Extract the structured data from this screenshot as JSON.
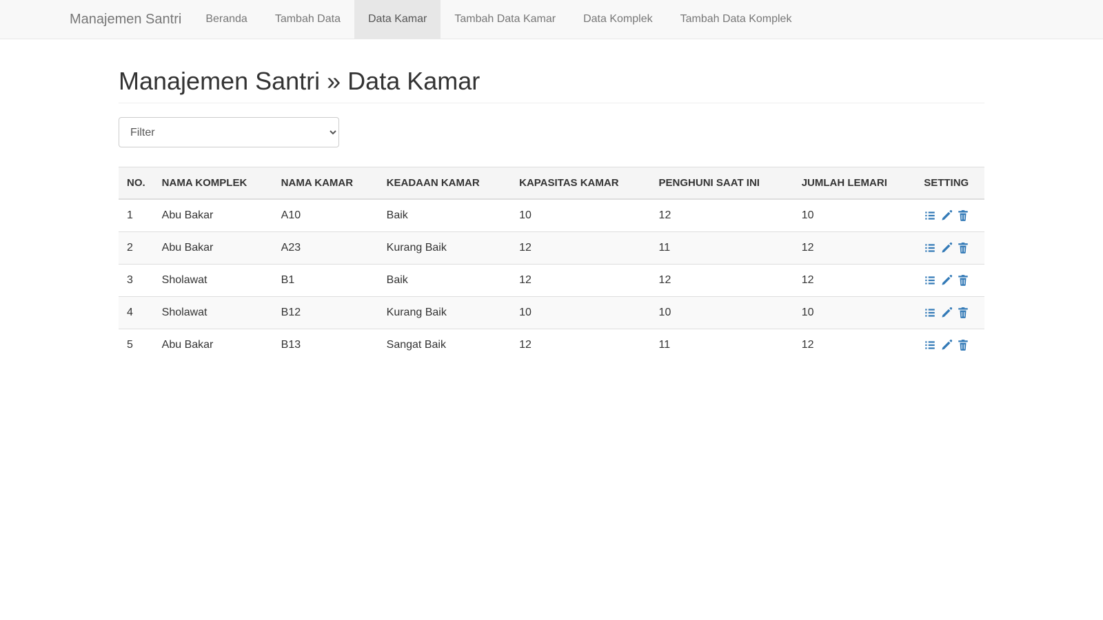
{
  "brand": "Manajemen Santri",
  "nav": [
    {
      "label": "Beranda",
      "active": false
    },
    {
      "label": "Tambah Data",
      "active": false
    },
    {
      "label": "Data Kamar",
      "active": true
    },
    {
      "label": "Tambah Data Kamar",
      "active": false
    },
    {
      "label": "Data Komplek",
      "active": false
    },
    {
      "label": "Tambah Data Komplek",
      "active": false
    }
  ],
  "page_title": "Manajemen Santri » Data Kamar",
  "filter": {
    "placeholder": "Filter"
  },
  "table": {
    "headers": {
      "no": "NO.",
      "nama_komplek": "NAMA KOMPLEK",
      "nama_kamar": "NAMA KAMAR",
      "keadaan_kamar": "KEADAAN KAMAR",
      "kapasitas_kamar": "KAPASITAS KAMAR",
      "penghuni_saat_ini": "PENGHUNI SAAT INI",
      "jumlah_lemari": "JUMLAH LEMARI",
      "setting": "SETTING"
    },
    "rows": [
      {
        "no": "1",
        "nama_komplek": "Abu Bakar",
        "nama_kamar": "A10",
        "keadaan_kamar": "Baik",
        "kapasitas_kamar": "10",
        "penghuni_saat_ini": "12",
        "jumlah_lemari": "10"
      },
      {
        "no": "2",
        "nama_komplek": "Abu Bakar",
        "nama_kamar": "A23",
        "keadaan_kamar": "Kurang Baik",
        "kapasitas_kamar": "12",
        "penghuni_saat_ini": "11",
        "jumlah_lemari": "12"
      },
      {
        "no": "3",
        "nama_komplek": "Sholawat",
        "nama_kamar": "B1",
        "keadaan_kamar": "Baik",
        "kapasitas_kamar": "12",
        "penghuni_saat_ini": "12",
        "jumlah_lemari": "12"
      },
      {
        "no": "4",
        "nama_komplek": "Sholawat",
        "nama_kamar": "B12",
        "keadaan_kamar": "Kurang Baik",
        "kapasitas_kamar": "10",
        "penghuni_saat_ini": "10",
        "jumlah_lemari": "10"
      },
      {
        "no": "5",
        "nama_komplek": "Abu Bakar",
        "nama_kamar": "B13",
        "keadaan_kamar": "Sangat Baik",
        "kapasitas_kamar": "12",
        "penghuni_saat_ini": "11",
        "jumlah_lemari": "12"
      }
    ]
  }
}
